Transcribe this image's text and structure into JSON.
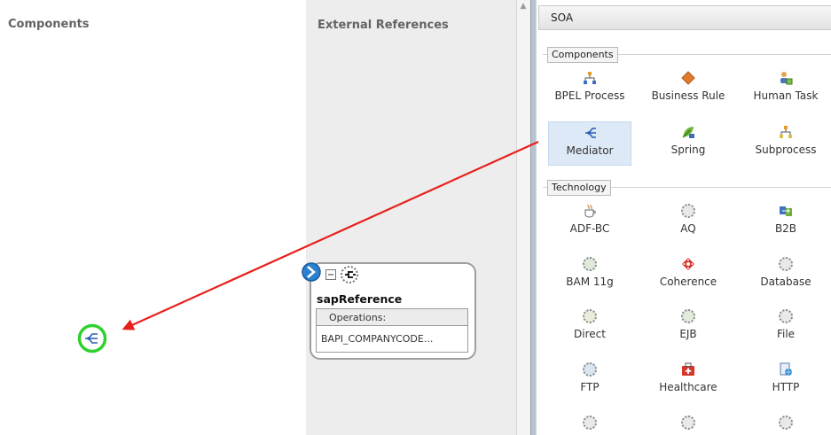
{
  "lanes": {
    "components_title": "Components",
    "external_title": "External References"
  },
  "palette": {
    "title": "SOA",
    "groups": [
      {
        "label": "Components",
        "items": [
          {
            "label": "BPEL Process",
            "icon": "bpel-process-icon"
          },
          {
            "label": "Business Rule",
            "icon": "business-rule-icon"
          },
          {
            "label": "Human Task",
            "icon": "human-task-icon"
          },
          {
            "label": "Mediator",
            "icon": "mediator-icon",
            "selected": true
          },
          {
            "label": "Spring",
            "icon": "spring-icon"
          },
          {
            "label": "Subprocess",
            "icon": "subprocess-icon"
          }
        ]
      },
      {
        "label": "Technology",
        "items": [
          {
            "label": "ADF-BC",
            "icon": "adf-bc-icon"
          },
          {
            "label": "AQ",
            "icon": "aq-icon"
          },
          {
            "label": "B2B",
            "icon": "b2b-icon"
          },
          {
            "label": "BAM 11g",
            "icon": "bam-icon"
          },
          {
            "label": "Coherence",
            "icon": "coherence-icon"
          },
          {
            "label": "Database",
            "icon": "database-icon"
          },
          {
            "label": "Direct",
            "icon": "direct-icon"
          },
          {
            "label": "EJB",
            "icon": "ejb-icon"
          },
          {
            "label": "File",
            "icon": "file-icon"
          },
          {
            "label": "FTP",
            "icon": "ftp-icon"
          },
          {
            "label": "Healthcare",
            "icon": "healthcare-icon"
          },
          {
            "label": "HTTP",
            "icon": "http-icon"
          }
        ]
      }
    ]
  },
  "reference": {
    "name": "sapReference",
    "operations_label": "Operations:",
    "operation": "BAPI_COMPANYCODE..."
  },
  "colors": {
    "arrow": "#e8201c",
    "drop_ring": "#2fd12f",
    "selection": "#dde9f6",
    "lane_gray": "#ededed"
  }
}
